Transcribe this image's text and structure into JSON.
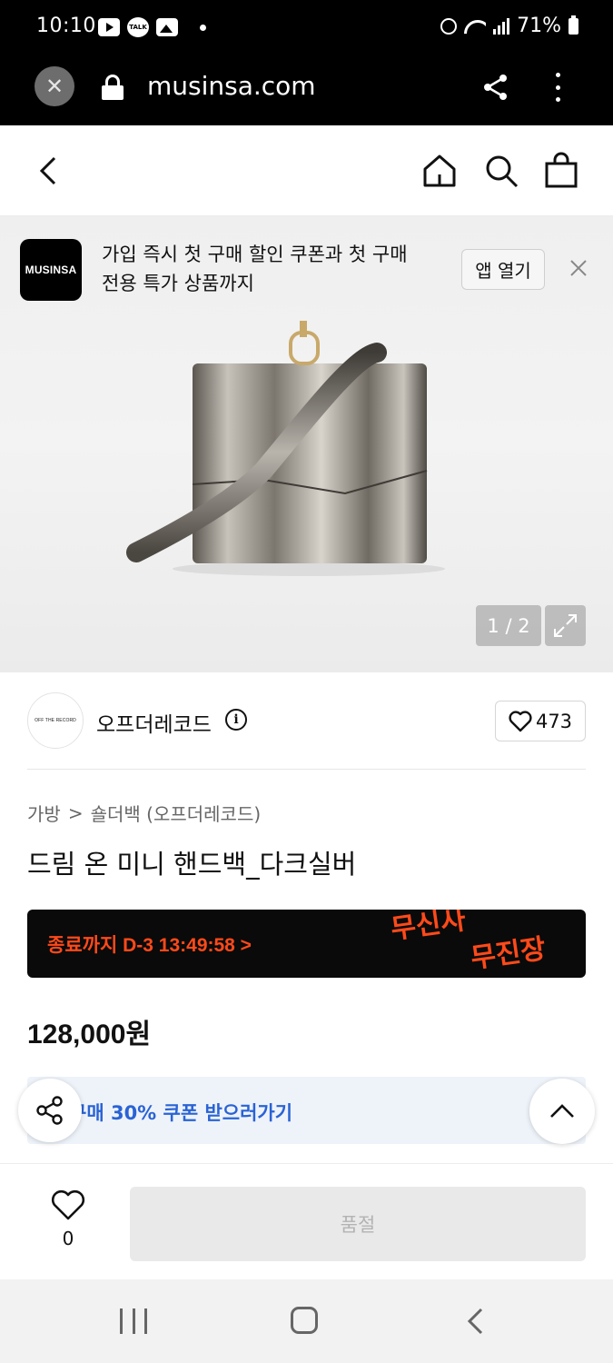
{
  "status_bar": {
    "time": "10:10",
    "talk_badge": "TALK",
    "battery": "71%"
  },
  "browser": {
    "url": "musinsa.com",
    "close_icon": "close-icon",
    "lock_icon": "lock-icon",
    "share_icon": "share-icon",
    "menu_icon": "more-vertical-icon"
  },
  "top_nav": {
    "back_icon": "chevron-left-icon",
    "home_icon": "home-icon",
    "search_icon": "search-icon",
    "cart_icon": "shopping-bag-icon"
  },
  "app_banner": {
    "logo_text": "MUSINSA",
    "message_line1": "가입 즉시 첫 구매 할인 쿠폰과 첫 구매",
    "message_line2": "전용 특가 상품까지",
    "open_button": "앱 열기"
  },
  "gallery": {
    "counter": "1 / 2",
    "current_image": 1,
    "total_images": 2
  },
  "brand": {
    "avatar_text": "OFF THE RECORD",
    "name": "오프더레코드",
    "info_icon": "i",
    "like_count": "473"
  },
  "product": {
    "breadcrumb_category": "가방",
    "breadcrumb_separator": ">",
    "breadcrumb_sub": "숄더백 (오프더레코드)",
    "title": "드림 온 미니 핸드백_다크실버",
    "price": "128,000원"
  },
  "promo": {
    "timer_text": "종료까지 D-3 13:49:58 >",
    "logo_line1": "무신사",
    "logo_line2": "무진장",
    "accent": "#ff4a1a"
  },
  "coupon": {
    "text": "구매 30% 쿠폰 받으러가기",
    "accent": "#2a63d4"
  },
  "bottom_bar": {
    "wish_count": "0",
    "buy_button": "품절"
  },
  "system_nav": {
    "recent_icon": "recent-apps-icon",
    "home_icon": "home-circle-icon",
    "back_icon": "back-icon"
  }
}
